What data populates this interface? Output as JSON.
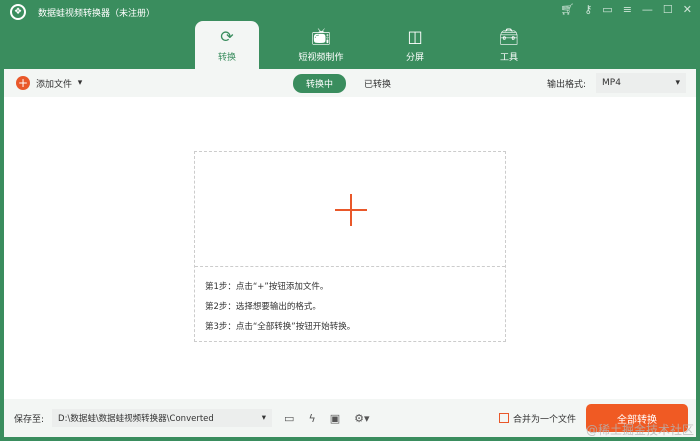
{
  "app": {
    "title": "数据蛙视频转换器（未注册）",
    "logo_text": "数据蛙"
  },
  "window_controls": [
    "cart-icon",
    "key-icon",
    "chat-icon",
    "menu-icon",
    "minimize-icon",
    "maximize-icon",
    "close-icon"
  ],
  "tabs": [
    {
      "label": "转换",
      "icon": "convert-icon",
      "active": true
    },
    {
      "label": "短视频制作",
      "icon": "tv-icon"
    },
    {
      "label": "分屏",
      "icon": "split-screen-icon"
    },
    {
      "label": "工具",
      "icon": "toolbox-icon"
    }
  ],
  "toolbar": {
    "add_file": "添加文件",
    "segments": [
      "转换中",
      "已转换"
    ],
    "active_segment": "转换中",
    "output_format_label": "输出格式:",
    "output_format": "MP4"
  },
  "steps": [
    "第1步：点击“+”按钮添加文件。",
    "第2步：选择想要输出的格式。",
    "第3步：点击“全部转换”按钮开始转换。"
  ],
  "bottom": {
    "save_label": "保存至:",
    "save_path": "D:\\数据蛙\\数据蛙视频转换器\\Converted",
    "merge_label": "合并为一个文件",
    "merge_checked": false,
    "convert_all": "全部转换"
  },
  "watermark": "@稀土掘金技术社区",
  "colors": {
    "brand": "#3a8d5e",
    "accent": "#f05a23"
  }
}
